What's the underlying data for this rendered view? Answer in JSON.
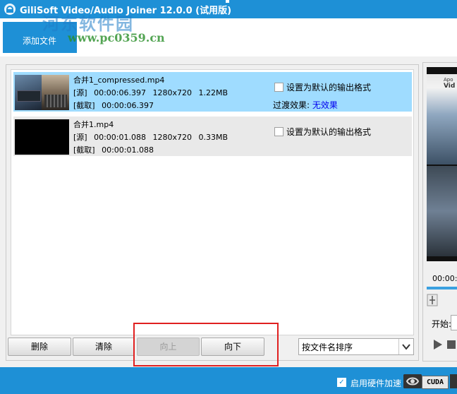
{
  "window": {
    "title": "GiliSoft Video/Audio Joiner 12.0.0 (试用版)"
  },
  "watermark": {
    "text": "河东软件园",
    "url": "www.pc0359.cn"
  },
  "toolbar": {
    "add_file_label": "添加文件"
  },
  "files": [
    {
      "name": "合并1_compressed.mp4",
      "source_tag": "[源]",
      "source_duration": "00:00:06.397",
      "resolution": "1280x720",
      "size": "1.22MB",
      "clip_tag": "[截取]",
      "clip_duration": "00:00:06.397",
      "default_format_label": "设置为默认的输出格式",
      "transition_label": "过渡效果:",
      "transition_value": "无效果",
      "selected": true
    },
    {
      "name": "合并1.mp4",
      "source_tag": "[源]",
      "source_duration": "00:00:01.088",
      "resolution": "1280x720",
      "size": "0.33MB",
      "clip_tag": "[截取]",
      "clip_duration": "00:00:01.088",
      "default_format_label": "设置为默认的输出格式",
      "selected": false
    }
  ],
  "buttons": {
    "delete": "删除",
    "clear": "清除",
    "move_up": "向上",
    "move_down": "向下"
  },
  "sort": {
    "selected": "按文件名排序"
  },
  "preview": {
    "overlay_line1": "Apo",
    "overlay_line2": "Vid",
    "time": "00:00:",
    "start_label": "开始:"
  },
  "statusbar": {
    "hw_accel_label": "启用硬件加速",
    "hw_accel_checked": true,
    "cuda_label": "CUDA"
  }
}
